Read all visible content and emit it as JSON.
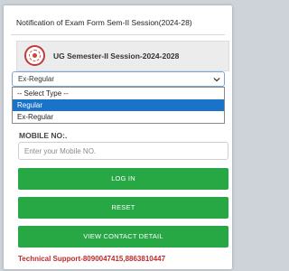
{
  "notice": {
    "title": "Notification of Exam Form Sem-II Session(2024-28)"
  },
  "session": {
    "logo_icon": "university-seal-icon",
    "title": "UG Semester-II Session-2024-2028"
  },
  "type_select": {
    "value": "Ex-Regular",
    "chevron_icon": "chevron-down-icon",
    "options": [
      {
        "label": "-- Select Type --",
        "selected": false
      },
      {
        "label": "Regular",
        "selected": true
      },
      {
        "label": "Ex-Regular",
        "selected": false
      }
    ]
  },
  "mobile": {
    "label": "MOBILE NO:.",
    "placeholder": "Enter your Mobile NO.",
    "value": ""
  },
  "buttons": {
    "login": "LOG IN",
    "reset": "RESET",
    "contact": "VIEW CONTACT DETAIL"
  },
  "support": {
    "text": "Technical Support-8090047415,8863810447"
  },
  "colors": {
    "button_green": "#28a745",
    "support_red": "#c0292b",
    "selected_blue": "#1a73c9"
  }
}
